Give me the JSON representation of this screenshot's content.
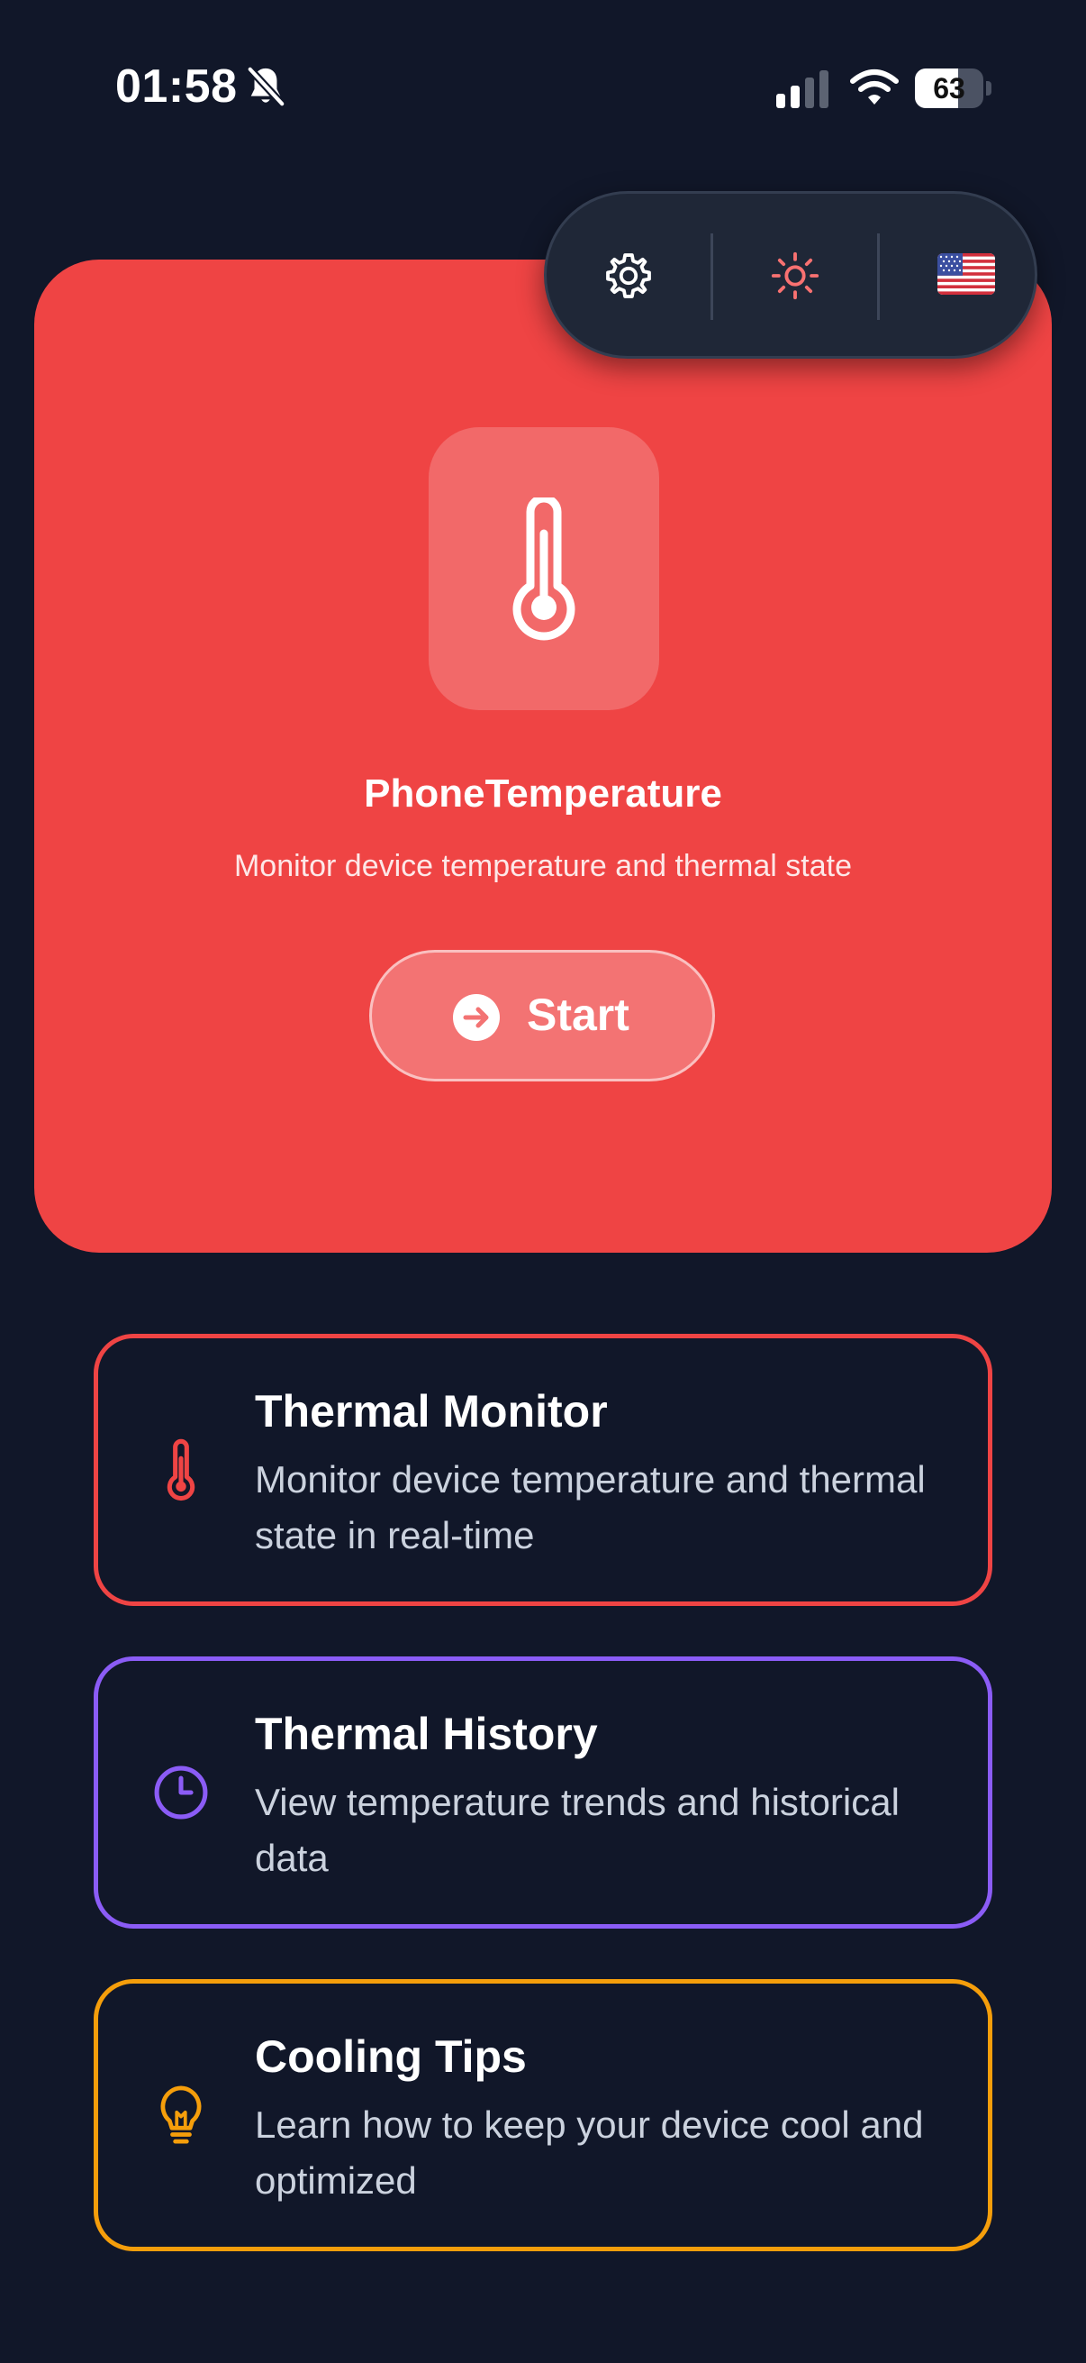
{
  "status_bar": {
    "time": "01:58",
    "battery_level": "63",
    "battery_fraction": 0.63
  },
  "toolbar": {
    "settings_icon": "gear-icon",
    "theme_icon": "sun-icon",
    "language_icon": "us-flag-icon",
    "accent_color": "#f87171"
  },
  "hero": {
    "title": "PhoneTemperature",
    "subtitle": "Monitor device temperature and thermal state",
    "start_label": "Start",
    "icon": "thermometer-icon",
    "background_color": "#ef4444"
  },
  "features": [
    {
      "title": "Thermal Monitor",
      "description": "Monitor device temperature and thermal state in real-time",
      "icon": "thermometer-icon",
      "color": "#ef4444"
    },
    {
      "title": "Thermal History",
      "description": "View temperature trends and historical data",
      "icon": "clock-icon",
      "color": "#8b5cf6"
    },
    {
      "title": "Cooling Tips",
      "description": "Learn how to keep your device cool and optimized",
      "icon": "lightbulb-icon",
      "color": "#f59e0b"
    }
  ]
}
